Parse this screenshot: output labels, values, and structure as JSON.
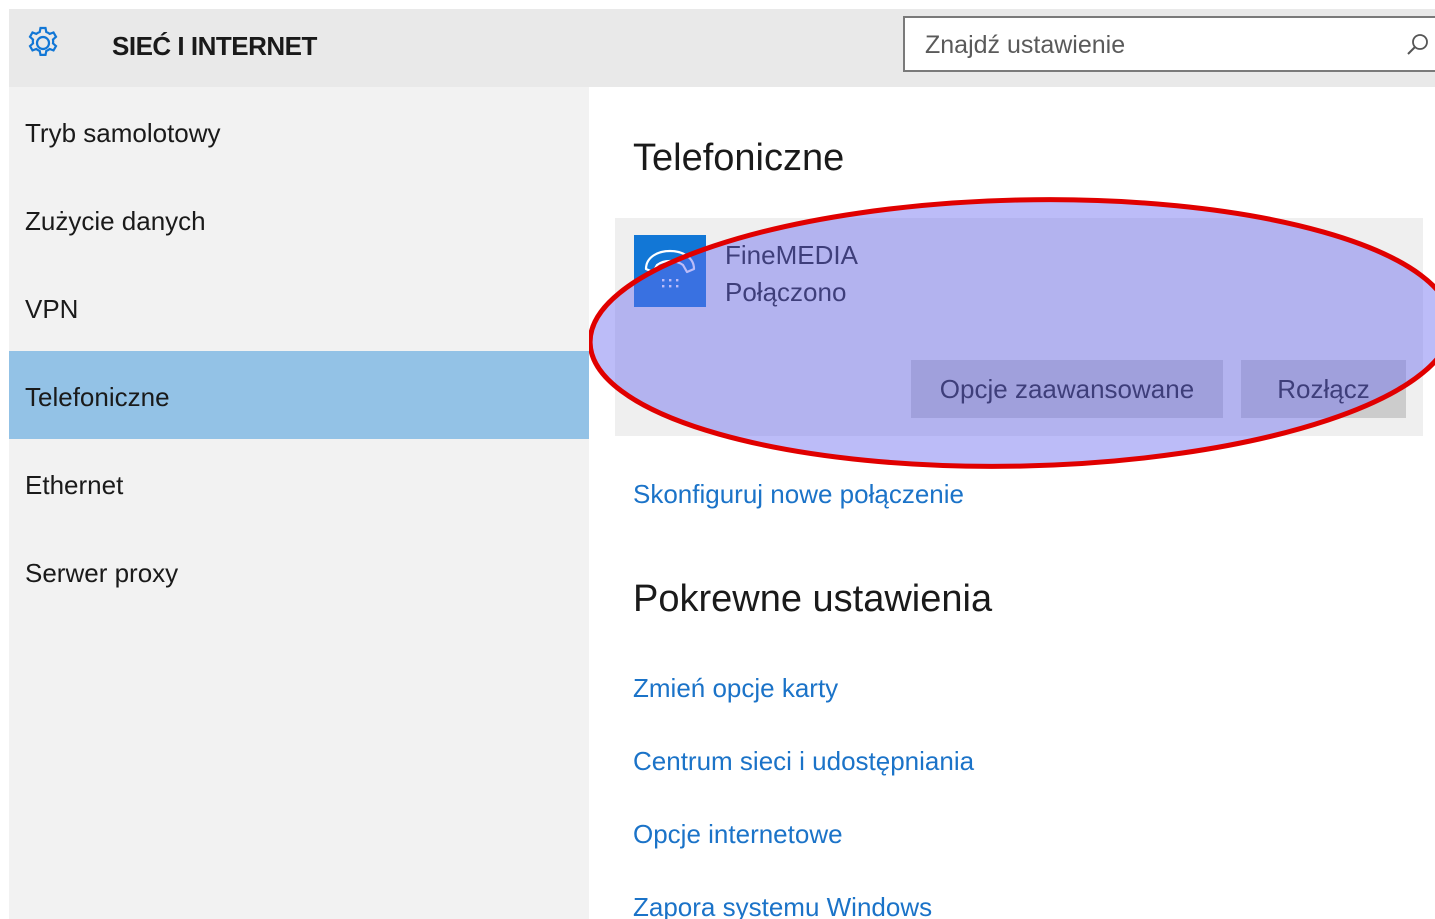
{
  "header": {
    "title": "SIEĆ I INTERNET",
    "gear_icon": "gear-icon",
    "search": {
      "placeholder": "Znajdź ustawienie",
      "icon": "search-icon"
    }
  },
  "sidebar": {
    "items": [
      {
        "label": "Tryb samolotowy",
        "selected": false
      },
      {
        "label": "Zużycie danych",
        "selected": false
      },
      {
        "label": "VPN",
        "selected": false
      },
      {
        "label": "Telefoniczne",
        "selected": true
      },
      {
        "label": "Ethernet",
        "selected": false
      },
      {
        "label": "Serwer proxy",
        "selected": false
      }
    ]
  },
  "main": {
    "title": "Telefoniczne",
    "connection": {
      "icon": "dialup-phone-icon",
      "name": "FineMEDIA",
      "status": "Połączono",
      "advanced_button": "Opcje zaawansowane",
      "disconnect_button": "Rozłącz"
    },
    "setup_link": "Skonfiguruj nowe połączenie",
    "related_title": "Pokrewne ustawienia",
    "related_links": [
      "Zmień opcje karty",
      "Centrum sieci i udostępniania",
      "Opcje internetowe",
      "Zapora systemu Windows"
    ]
  },
  "colors": {
    "accent": "#1277d6",
    "selected_nav": "#93c2e6",
    "link": "#1b73c8",
    "highlight_fill": "#b3b3f5",
    "highlight_stroke": "#e00000"
  }
}
